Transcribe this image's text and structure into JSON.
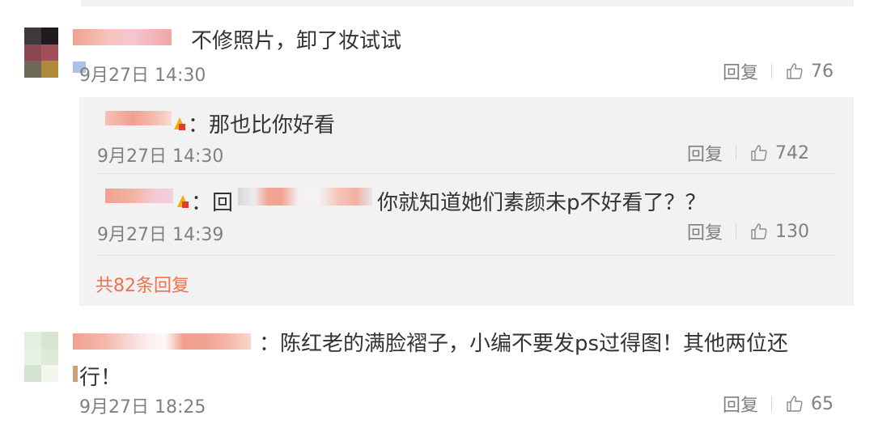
{
  "colors": {
    "text": "#333333",
    "muted": "#808080",
    "link": "#eb7350",
    "reply_box": "#f2f2f2"
  },
  "comments": [
    {
      "text": "不修照片，卸了妆试试",
      "time": "9月27日 14:30",
      "reply_label": "回复",
      "likes": "76"
    },
    {
      "text": "：陈红老的满脸褶子，小编不要发ps过得图！其他两位还",
      "text_line2": "行！",
      "time": "9月27日 18:25",
      "reply_label": "回复",
      "likes": "65"
    }
  ],
  "replies": [
    {
      "text": "：那也比你好看",
      "time": "9月27日 14:30",
      "reply_label": "回复",
      "likes": "742"
    },
    {
      "prefix": "：回",
      "text": "你就知道她们素颜未p不好看了？？",
      "time": "9月27日 14:39",
      "reply_label": "回复",
      "likes": "130"
    }
  ],
  "more_replies": "共82条回复"
}
